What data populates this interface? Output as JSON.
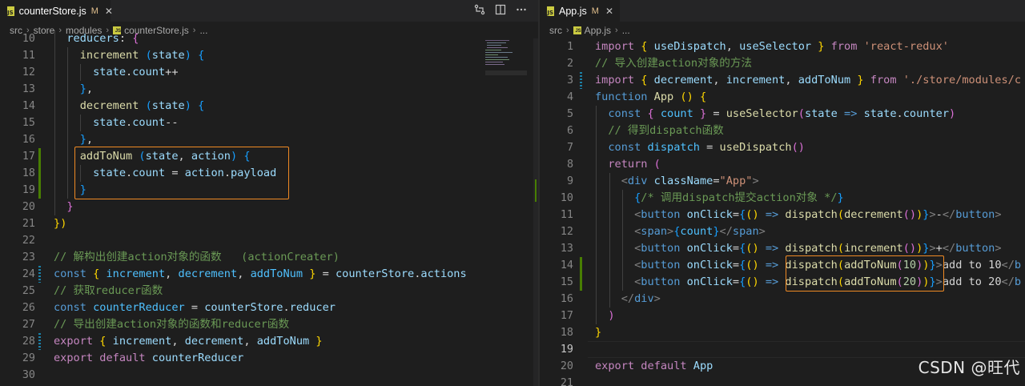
{
  "left": {
    "tab": {
      "filename": "counterStore.js",
      "status": "M",
      "close": "✕",
      "badge": "JS"
    },
    "tab_actions": [
      "compare-icon",
      "split-editor-icon",
      "more-icon"
    ],
    "breadcrumb": [
      "src",
      "store",
      "modules",
      "counterStore.js",
      "..."
    ],
    "lines": [
      {
        "n": "10",
        "html": "<span class=\"var\">  reducers</span><span class=\"pun\">: </span><span class=\"br2\">{</span>"
      },
      {
        "n": "11",
        "html": "<span class=\"fn\">    increment</span><span class=\"pun\"> </span><span class=\"br3\">(</span><span class=\"var\">state</span><span class=\"br3\">)</span><span class=\"pun\"> </span><span class=\"br3\">{</span>"
      },
      {
        "n": "12",
        "html": "<span class=\"var\">      state</span><span class=\"pun\">.</span><span class=\"var\">count</span><span class=\"pun\">++</span>"
      },
      {
        "n": "13",
        "html": "<span class=\"br3\">    }</span><span class=\"pun\">,</span>"
      },
      {
        "n": "14",
        "html": "<span class=\"fn\">    decrement</span><span class=\"pun\"> </span><span class=\"br3\">(</span><span class=\"var\">state</span><span class=\"br3\">)</span><span class=\"pun\"> </span><span class=\"br3\">{</span>"
      },
      {
        "n": "15",
        "html": "<span class=\"var\">      state</span><span class=\"pun\">.</span><span class=\"var\">count</span><span class=\"pun\">--</span>"
      },
      {
        "n": "16",
        "html": "<span class=\"br3\">    }</span><span class=\"pun\">,</span>"
      },
      {
        "n": "17",
        "html": "<span class=\"fn\">    addToNum</span><span class=\"pun\"> </span><span class=\"br3\">(</span><span class=\"var\">state</span><span class=\"pun\">, </span><span class=\"var\">action</span><span class=\"br3\">)</span><span class=\"pun\"> </span><span class=\"br3\">{</span>"
      },
      {
        "n": "18",
        "html": "<span class=\"var\">      state</span><span class=\"pun\">.</span><span class=\"var\">count</span><span class=\"pun\"> = </span><span class=\"var\">action</span><span class=\"pun\">.</span><span class=\"var\">payload</span>"
      },
      {
        "n": "19",
        "html": "<span class=\"br3\">    }</span>"
      },
      {
        "n": "20",
        "html": "<span class=\"br2\">  }</span>"
      },
      {
        "n": "21",
        "html": "<span class=\"br1\">}</span><span class=\"br1\">)</span>"
      },
      {
        "n": "22",
        "html": ""
      },
      {
        "n": "23",
        "html": "<span class=\"com\">// 解构出创建action对象的函数   (actionCreater)</span>"
      },
      {
        "n": "24",
        "html": "<span class=\"blue\">const</span><span class=\"pun\"> </span><span class=\"br1\">{</span><span class=\"cyan\"> increment</span><span class=\"pun\">, </span><span class=\"cyan\">decrement</span><span class=\"pun\">, </span><span class=\"cyan\">addToNum</span><span class=\"pun\"> </span><span class=\"br1\">}</span><span class=\"pun\"> = </span><span class=\"var\">counterStore</span><span class=\"pun\">.</span><span class=\"var\">actions</span>"
      },
      {
        "n": "25",
        "html": "<span class=\"com\">// 获取reducer函数</span>"
      },
      {
        "n": "26",
        "html": "<span class=\"blue\">const</span><span class=\"pun\"> </span><span class=\"cyan\">counterReducer</span><span class=\"pun\"> = </span><span class=\"var\">counterStore</span><span class=\"pun\">.</span><span class=\"var\">reducer</span>"
      },
      {
        "n": "27",
        "html": "<span class=\"com\">// 导出创建action对象的函数和reducer函数</span>"
      },
      {
        "n": "28",
        "html": "<span class=\"kw\">export</span><span class=\"pun\"> </span><span class=\"br1\">{</span><span class=\"var\"> increment</span><span class=\"pun\">, </span><span class=\"var\">decrement</span><span class=\"pun\">, </span><span class=\"var\">addToNum</span><span class=\"pun\"> </span><span class=\"br1\">}</span>"
      },
      {
        "n": "29",
        "html": "<span class=\"kw\">export</span><span class=\"pun\"> </span><span class=\"kw\">default</span><span class=\"pun\"> </span><span class=\"var\">counterReducer</span>"
      },
      {
        "n": "30",
        "html": ""
      }
    ]
  },
  "right": {
    "tab": {
      "filename": "App.js",
      "status": "M",
      "close": "✕",
      "badge": "JS"
    },
    "breadcrumb": [
      "src",
      "App.js",
      "..."
    ],
    "lines": [
      {
        "n": "1",
        "html": "<span class=\"kw\">import</span><span class=\"pun\"> </span><span class=\"br1\">{</span><span class=\"var\"> useDispatch</span><span class=\"pun\">, </span><span class=\"var\">useSelector</span><span class=\"pun\"> </span><span class=\"br1\">}</span><span class=\"kw\"> from</span><span class=\"str\"> 'react-redux'</span>"
      },
      {
        "n": "2",
        "html": "<span class=\"com\">// 导入创建action对象的方法</span>"
      },
      {
        "n": "3",
        "html": "<span class=\"kw\">import</span><span class=\"pun\"> </span><span class=\"br1\">{</span><span class=\"var\"> decrement</span><span class=\"pun\">, </span><span class=\"var\">increment</span><span class=\"pun\">, </span><span class=\"var\">addToNum</span><span class=\"pun\"> </span><span class=\"br1\">}</span><span class=\"kw\"> from</span><span class=\"str\"> './store/modules/c</span>"
      },
      {
        "n": "4",
        "html": "<span class=\"blue\">function</span><span class=\"fn\"> App</span><span class=\"pun\"> </span><span class=\"br1\">()</span><span class=\"pun\"> </span><span class=\"br1\">{</span>"
      },
      {
        "n": "5",
        "html": "<span class=\"blue\">  const</span><span class=\"pun\"> </span><span class=\"br2\">{</span><span class=\"cyan\"> count</span><span class=\"pun\"> </span><span class=\"br2\">}</span><span class=\"pun\"> = </span><span class=\"fn\">useSelector</span><span class=\"br2\">(</span><span class=\"var\">state</span><span class=\"blue\"> =&gt;</span><span class=\"var\"> state</span><span class=\"pun\">.</span><span class=\"var\">counter</span><span class=\"br2\">)</span>"
      },
      {
        "n": "6",
        "html": "<span class=\"com\">  // 得到dispatch函数</span>"
      },
      {
        "n": "7",
        "html": "<span class=\"blue\">  const</span><span class=\"pun\"> </span><span class=\"cyan\">dispatch</span><span class=\"pun\"> = </span><span class=\"fn\">useDispatch</span><span class=\"br2\">()</span>"
      },
      {
        "n": "8",
        "html": "<span class=\"kw\">  return</span><span class=\"pun\"> </span><span class=\"br2\">(</span>"
      },
      {
        "n": "9",
        "html": "<span class=\"tagp\">    &lt;</span><span class=\"tag\">div</span><span class=\"attr\"> className</span><span class=\"pun\">=</span><span class=\"str\">\"App\"</span><span class=\"tagp\">&gt;</span>"
      },
      {
        "n": "10",
        "html": "<span class=\"br3\">      {</span><span class=\"com\">/* 调用dispatch提交action对象 */</span><span class=\"br3\">}</span>"
      },
      {
        "n": "11",
        "html": "<span class=\"tagp\">      &lt;</span><span class=\"tag\">button</span><span class=\"attr\"> onClick</span><span class=\"pun\">=</span><span class=\"br3\">{</span><span class=\"br1\">()</span><span class=\"blue\"> =&gt;</span><span class=\"fn\"> dispatch</span><span class=\"br1\">(</span><span class=\"fn\">decrement</span><span class=\"br2\">()</span><span class=\"br1\">)</span><span class=\"br3\">}</span><span class=\"tagp\">&gt;</span><span class=\"txt\">-</span><span class=\"tagp\">&lt;/</span><span class=\"tag\">button</span><span class=\"tagp\">&gt;</span>"
      },
      {
        "n": "12",
        "html": "<span class=\"tagp\">      &lt;</span><span class=\"tag\">span</span><span class=\"tagp\">&gt;</span><span class=\"br3\">{</span><span class=\"cyan\">count</span><span class=\"br3\">}</span><span class=\"tagp\">&lt;/</span><span class=\"tag\">span</span><span class=\"tagp\">&gt;</span>"
      },
      {
        "n": "13",
        "html": "<span class=\"tagp\">      &lt;</span><span class=\"tag\">button</span><span class=\"attr\"> onClick</span><span class=\"pun\">=</span><span class=\"br3\">{</span><span class=\"br1\">()</span><span class=\"blue\"> =&gt;</span><span class=\"fn\"> dispatch</span><span class=\"br1\">(</span><span class=\"fn\">increment</span><span class=\"br2\">()</span><span class=\"br1\">)</span><span class=\"br3\">}</span><span class=\"tagp\">&gt;</span><span class=\"txt\">+</span><span class=\"tagp\">&lt;/</span><span class=\"tag\">button</span><span class=\"tagp\">&gt;</span>"
      },
      {
        "n": "14",
        "html": "<span class=\"tagp\">      &lt;</span><span class=\"tag\">button</span><span class=\"attr\"> onClick</span><span class=\"pun\">=</span><span class=\"br3\">{</span><span class=\"br1\">()</span><span class=\"blue\"> =&gt;</span><span class=\"fn\"> dispatch</span><span class=\"br1\">(</span><span class=\"fn\">addToNum</span><span class=\"br2\">(</span><span class=\"num\">10</span><span class=\"br2\">)</span><span class=\"br1\">)</span><span class=\"br3\">}</span><span class=\"tagp\">&gt;</span><span class=\"txt\">add to 10</span><span class=\"tagp\">&lt;/</span><span class=\"tag\">b</span>"
      },
      {
        "n": "15",
        "html": "<span class=\"tagp\">      &lt;</span><span class=\"tag\">button</span><span class=\"attr\"> onClick</span><span class=\"pun\">=</span><span class=\"br3\">{</span><span class=\"br1\">()</span><span class=\"blue\"> =&gt;</span><span class=\"fn\"> dispatch</span><span class=\"br1\">(</span><span class=\"fn\">addToNum</span><span class=\"br2\">(</span><span class=\"num\">20</span><span class=\"br2\">)</span><span class=\"br1\">)</span><span class=\"br3\">}</span><span class=\"tagp\">&gt;</span><span class=\"txt\">add to 20</span><span class=\"tagp\">&lt;/</span><span class=\"tag\">b</span>"
      },
      {
        "n": "16",
        "html": "<span class=\"tagp\">    &lt;/</span><span class=\"tag\">div</span><span class=\"tagp\">&gt;</span>"
      },
      {
        "n": "17",
        "html": "<span class=\"br2\">  )</span>"
      },
      {
        "n": "18",
        "html": "<span class=\"br1\">}</span>"
      },
      {
        "n": "19",
        "html": ""
      },
      {
        "n": "20",
        "html": "<span class=\"kw\">export</span><span class=\"pun\"> </span><span class=\"kw\">default</span><span class=\"pun\"> </span><span class=\"var\">App</span>"
      },
      {
        "n": "21",
        "html": ""
      }
    ]
  },
  "watermark": "CSDN @旺代",
  "colors": {
    "highlight": "#f08a24",
    "git_added": "#487e02",
    "git_modified": "#1b81a8"
  }
}
